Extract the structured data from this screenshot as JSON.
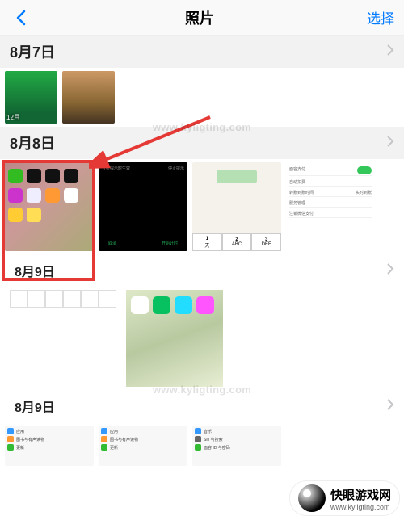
{
  "nav": {
    "title": "照片",
    "action": "选择"
  },
  "sections": [
    {
      "date": "8月7日"
    },
    {
      "date": "8月8日"
    },
    {
      "date": "8月9日"
    },
    {
      "date": "8月9日"
    }
  ],
  "badge": "12月",
  "tab": {
    "c1": "1",
    "c2": "2",
    "c3": "3",
    "l1": "天",
    "l2": "ABC",
    "l3": "DEF"
  },
  "settings": {
    "s1": "面容支付",
    "s2": "自动扣费",
    "s3": "转账到账时间",
    "s3v": "实时到账",
    "s4": "服务管理",
    "s5": "注销微信支付"
  },
  "darkThumb": {
    "title": "分析提示时生效",
    "right": "停止提示",
    "btn1": "取消",
    "btn2": "开始计时"
  },
  "list": {
    "a": "应用",
    "b": "图书与有声读物",
    "c": "更新",
    "d": "音乐",
    "e": "Siri 与搜索",
    "f": "面容 ID 与密码"
  },
  "watermark": "www.kyligting.com",
  "brand": {
    "name": "快眼游戏网",
    "sub": "www.kyligting.com"
  }
}
